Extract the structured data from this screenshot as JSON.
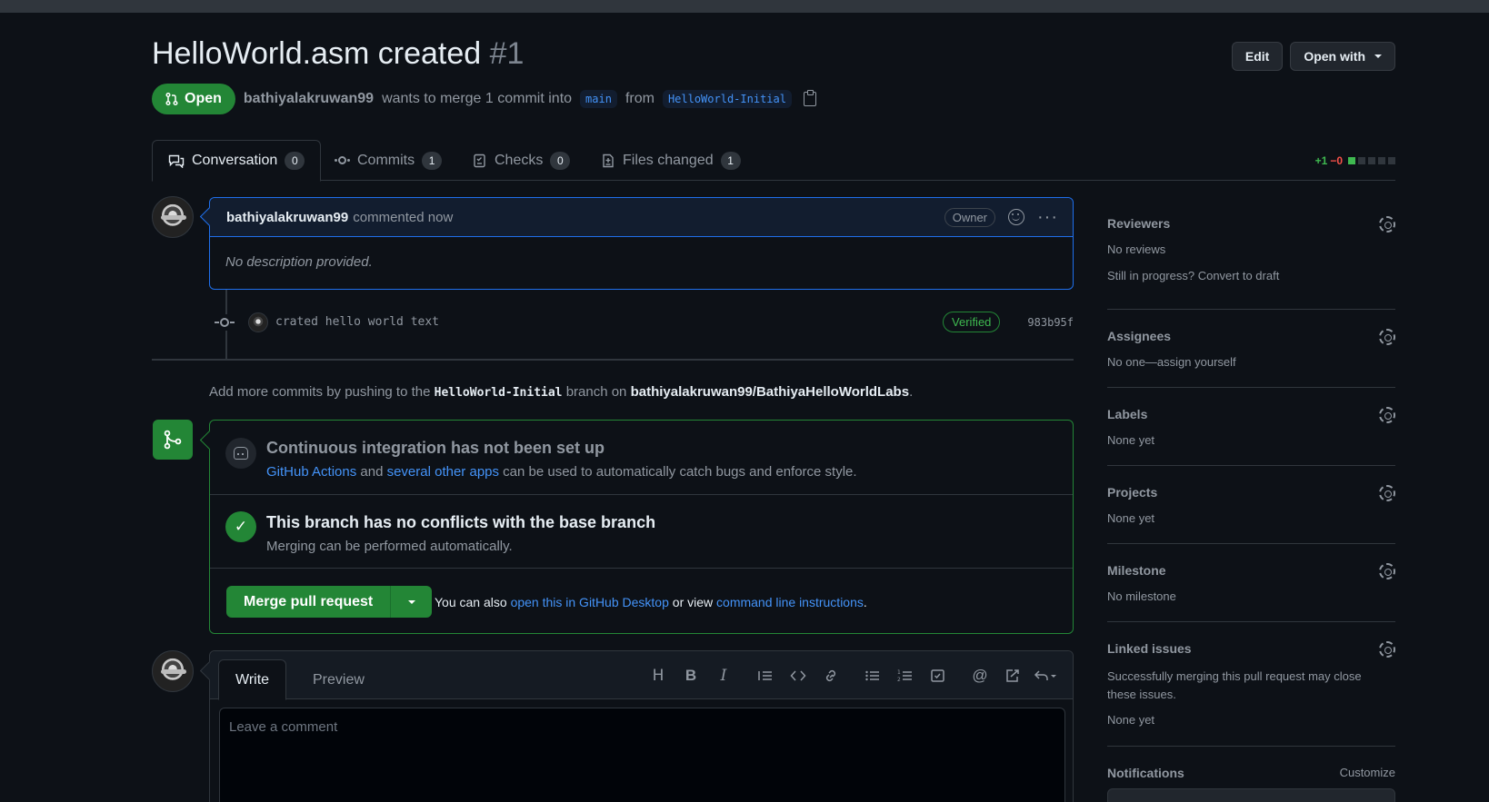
{
  "pr": {
    "title": "HelloWorld.asm created",
    "number": "#1",
    "state": "Open",
    "author": "bathiyalakruwan99",
    "merge_text": "wants to merge 1 commit into",
    "base_branch": "main",
    "from_text": "from",
    "head_branch": "HelloWorld-Initial"
  },
  "header_actions": {
    "edit_label": "Edit",
    "open_with_label": "Open with"
  },
  "tabs": [
    {
      "label": "Conversation",
      "count": "0"
    },
    {
      "label": "Commits",
      "count": "1"
    },
    {
      "label": "Checks",
      "count": "0"
    },
    {
      "label": "Files changed",
      "count": "1"
    }
  ],
  "diffstat": {
    "additions": "+1",
    "deletions": "−0"
  },
  "comment": {
    "author": "bathiyalakruwan99",
    "time": "commented now",
    "badge": "Owner",
    "body": "No description provided."
  },
  "commit": {
    "message": "crated hello world text",
    "verified": "Verified",
    "sha": "983b95f"
  },
  "push_message": {
    "prefix": "Add more commits by pushing to the",
    "branch": "HelloWorld-Initial",
    "middle": "branch on",
    "repo": "bathiyalakruwan99/BathiyaHelloWorldLabs",
    "suffix": "."
  },
  "merge_box": {
    "ci_title": "Continuous integration has not been set up",
    "ci_link1": "GitHub Actions",
    "ci_and": "and",
    "ci_link2": "several other apps",
    "ci_rest": "can be used to automatically catch bugs and enforce style.",
    "conflict_title": "This branch has no conflicts with the base branch",
    "conflict_sub": "Merging can be performed automatically.",
    "merge_button": "Merge pull request",
    "note_prefix": "You can also",
    "note_link1": "open this in GitHub Desktop",
    "note_or": "or view",
    "note_link2": "command line instructions",
    "note_suffix": "."
  },
  "composer": {
    "write_tab": "Write",
    "preview_tab": "Preview",
    "placeholder": "Leave a comment",
    "toolbar_icons": [
      "heading-icon",
      "bold-icon",
      "italic-icon",
      "quote-icon",
      "code-icon",
      "link-icon",
      "bullet-list-icon",
      "numbered-list-icon",
      "task-list-icon",
      "mention-icon",
      "cross-reference-icon",
      "saved-replies-icon"
    ]
  },
  "sidebar": {
    "reviewers_title": "Reviewers",
    "reviewers_value": "No reviews",
    "reviewers_draft": "Still in progress? Convert to draft",
    "assignees_title": "Assignees",
    "assignees_value": "No one—assign yourself",
    "labels_title": "Labels",
    "labels_value": "None yet",
    "projects_title": "Projects",
    "projects_value": "None yet",
    "milestone_title": "Milestone",
    "milestone_value": "No milestone",
    "linked_title": "Linked issues",
    "linked_desc": "Successfully merging this pull request may close these issues.",
    "linked_value": "None yet",
    "notifications_title": "Notifications",
    "notifications_action": "Customize"
  },
  "colors": {
    "background": "#0d1117",
    "accent_green": "#238636",
    "link_blue": "#4493f8",
    "border": "#30363d"
  }
}
